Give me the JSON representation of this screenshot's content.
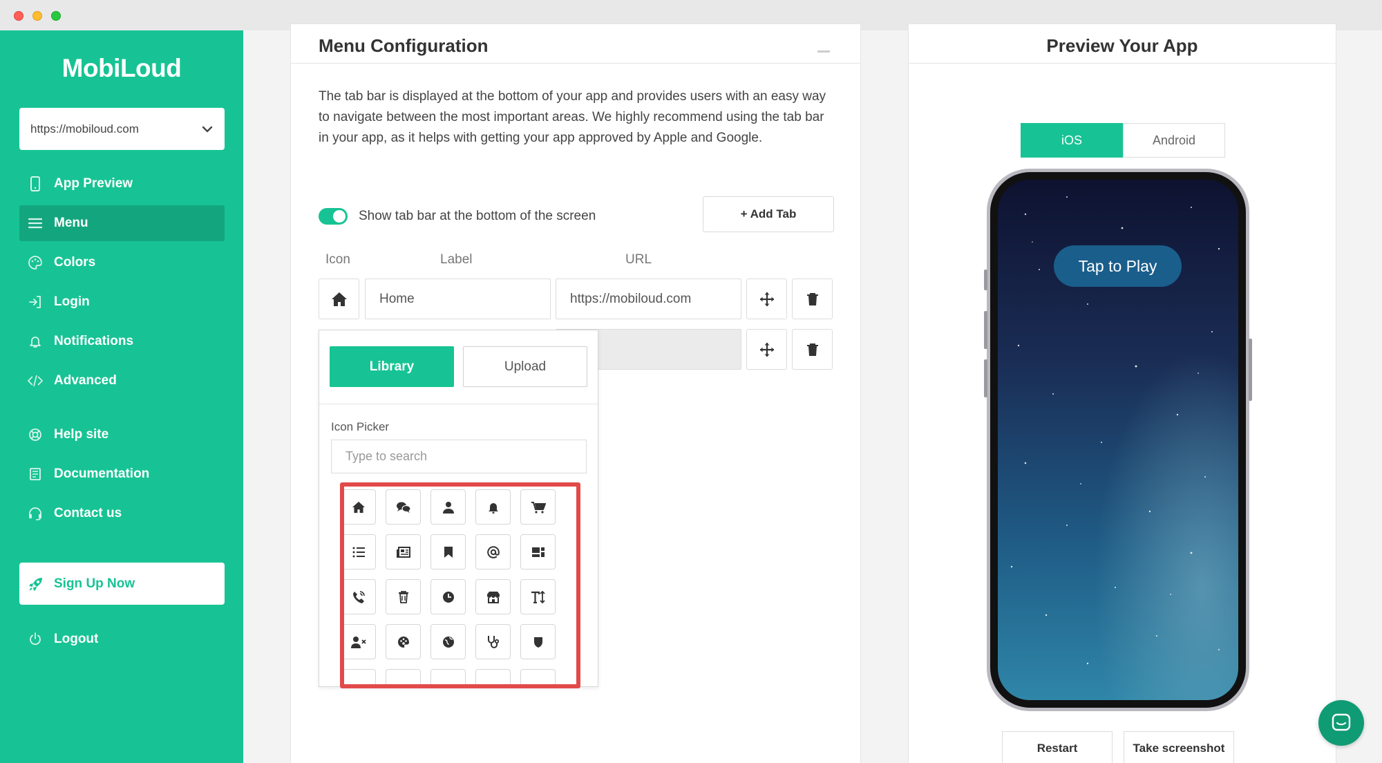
{
  "sidebar": {
    "logo": "MobiLoud",
    "site_select": "https://mobiloud.com",
    "items": [
      {
        "label": "App Preview",
        "icon": "phone-icon"
      },
      {
        "label": "Menu",
        "icon": "menu-icon",
        "active": true
      },
      {
        "label": "Colors",
        "icon": "palette-icon"
      },
      {
        "label": "Login",
        "icon": "login-icon"
      },
      {
        "label": "Notifications",
        "icon": "bell-icon"
      },
      {
        "label": "Advanced",
        "icon": "code-icon"
      },
      {
        "label": "Help site",
        "icon": "lifebuoy-icon"
      },
      {
        "label": "Documentation",
        "icon": "book-icon"
      },
      {
        "label": "Contact us",
        "icon": "headset-icon"
      }
    ],
    "signup": "Sign Up Now",
    "logout": "Logout"
  },
  "config": {
    "title": "Menu Configuration",
    "description": "The tab bar is displayed at the bottom of your app and provides users with an easy way to navigate between the most important areas. We highly recommend using the tab bar in your app, as it helps with getting your app approved by Apple and Google.",
    "toggle_label": "Show tab bar at the bottom of the screen",
    "toggle_on": true,
    "add_tab": "+ Add Tab",
    "columns": {
      "icon": "Icon",
      "label": "Label",
      "url": "URL"
    },
    "rows": [
      {
        "icon": "home-icon",
        "label": "Home",
        "url": "https://mobiloud.com"
      },
      {
        "icon": "",
        "label": "",
        "url": ""
      }
    ]
  },
  "picker": {
    "library": "Library",
    "upload": "Upload",
    "label": "Icon Picker",
    "search_placeholder": "Type to search",
    "icons": [
      "home-icon",
      "comments-icon",
      "user-icon",
      "bell-icon",
      "cart-icon",
      "list-icon",
      "newspaper-icon",
      "bookmark-icon",
      "at-icon",
      "layout-icon",
      "phone-call-icon",
      "trash-icon",
      "clock-icon",
      "store-icon",
      "text-height-icon",
      "user-remove-icon",
      "palette-icon",
      "globe-icon",
      "stethoscope-icon",
      "shield-icon"
    ],
    "highlight_color": "#e24a4a"
  },
  "preview": {
    "title": "Preview Your App",
    "tabs": [
      "iOS",
      "Android"
    ],
    "active_tab": "iOS",
    "play": "Tap to Play",
    "restart": "Restart",
    "screenshot": "Take screenshot"
  },
  "colors": {
    "brand": "#17c394",
    "brand_dark": "#13a67e",
    "play": "#1a5e8c"
  }
}
